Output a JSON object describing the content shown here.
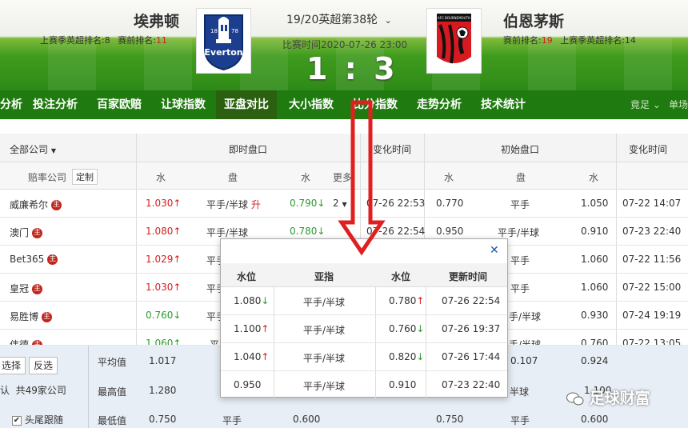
{
  "header": {
    "home_team": "埃弗顿",
    "home_last_rank_label": "上赛季英超排名:8",
    "home_current_rank_label": "赛前排名:",
    "home_current_rank": "11",
    "home_logo_text": "Everton",
    "home_logo_year_left": "18",
    "home_logo_year_right": "78",
    "match_title": "19/20英超第38轮",
    "match_time": "比赛时间2020-07-26 23:00",
    "score": "1 : 3",
    "away_team": "伯恩茅斯",
    "away_current_rank_label": "赛前排名:",
    "away_current_rank": "19",
    "away_last_rank_label": "上赛季英超排名:14",
    "away_logo_text": "AFC BOURNEMOUTH"
  },
  "nav": {
    "items": [
      "分析",
      "投注分析",
      "百家欧赔",
      "让球指数",
      "亚盘对比",
      "大小指数",
      "比分指数",
      "走势分析",
      "技术统计"
    ],
    "active_index": 4,
    "right_1": "竟足 ⌄",
    "right_2": "单场"
  },
  "table": {
    "company_filter": "全部公司",
    "live_header": "即时盘口",
    "change_time_header": "变化时间",
    "initial_header": "初始盘口",
    "change_time_header_2": "变化时间",
    "sub_company": "赔率公司",
    "customize": "定制",
    "sub_water": "水",
    "sub_handicap": "盘",
    "sub_more": "更多",
    "rows": [
      {
        "company": "威廉希尔",
        "live_home": "1.030↑",
        "live_line": "平手/半球",
        "live_line_flag": "升",
        "live_away": "0.790↓",
        "more": "2",
        "change_time": "07-26 22:53",
        "init_home": "0.770",
        "init_line": "平手",
        "init_away": "1.050",
        "init_time": "07-22 14:07"
      },
      {
        "company": "澳门",
        "live_home": "1.080↑",
        "live_line": "平手/半球",
        "live_away": "0.780↓",
        "change_time": "07-26 22:54",
        "init_home": "0.950",
        "init_line": "平手/半球",
        "init_away": "0.910",
        "init_time": "07-23 22:40"
      },
      {
        "company": "Bet365",
        "live_home": "1.029↑",
        "live_line": "平手",
        "init_line": "平手",
        "init_away": "1.060",
        "init_time": "07-22 11:56"
      },
      {
        "company": "皇冠",
        "live_home": "1.030↑",
        "live_line": "平手",
        "init_line": "平手",
        "init_away": "1.060",
        "init_time": "07-22 15:00"
      },
      {
        "company": "易胜博",
        "live_home": "0.760↓",
        "live_line": "平手",
        "init_line": "手/半球",
        "init_away": "0.930",
        "init_time": "07-24 19:19"
      },
      {
        "company": "伟德",
        "live_home": "1.060↑",
        "live_line": "平",
        "init_line": "手/半球",
        "init_away": "0.760",
        "init_time": "07-22 13:05"
      }
    ],
    "badge_glyph": "主"
  },
  "bottom": {
    "select_btn": "选择",
    "invert_btn": "反选",
    "count_prefix": "认",
    "count_text": "共49家公司",
    "follow_label": "头尾跟随",
    "avg_label": "平均值",
    "avg_value": "1.017",
    "max_label": "最高值",
    "max_value": "1.280",
    "min_label": "最低值",
    "min_value": "0.750",
    "min_line": "平手",
    "min_away": "0.600",
    "init_avg_home": "0.107",
    "init_avg_away": "0.924",
    "init_max_line": "半球",
    "init_max_away": "1.100",
    "init_min_home": "0.750",
    "init_min_line": "平手",
    "init_min_away": "0.600"
  },
  "popup": {
    "headers": [
      "水位",
      "亚指",
      "水位",
      "更新时间"
    ],
    "rows": [
      {
        "home": "1.080",
        "home_dir": "↓",
        "line": "平手/半球",
        "away": "0.780",
        "away_dir": "↑",
        "time": "07-26 22:54"
      },
      {
        "home": "1.100",
        "home_dir": "↑",
        "line": "平手/半球",
        "away": "0.760",
        "away_dir": "↓",
        "time": "07-26 19:37"
      },
      {
        "home": "1.040",
        "home_dir": "↑",
        "line": "平手/半球",
        "away": "0.820",
        "away_dir": "↓",
        "time": "07-26 17:44"
      },
      {
        "home": "0.950",
        "home_dir": "",
        "line": "平手/半球",
        "away": "0.910",
        "away_dir": "",
        "time": "07-23 22:40"
      }
    ],
    "close_glyph": "✕"
  },
  "watermark": "足球财富",
  "colors": {
    "nav_green": "#1f7a0f",
    "accent_red": "#d32020",
    "down_green": "#2a9a2a",
    "arrow_red": "#e02020"
  }
}
